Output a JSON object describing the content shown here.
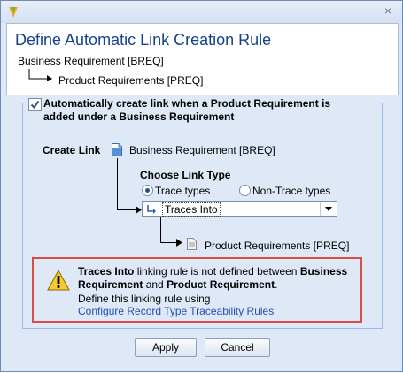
{
  "dialog": {
    "icons": {
      "app": "app-logo-icon",
      "close": "close-icon"
    },
    "close_glyph": "×"
  },
  "header": {
    "title": "Define Automatic Link Creation Rule",
    "source": "Business Requirement [BREQ]",
    "target": "Product Requirements [PREQ]"
  },
  "rule": {
    "checkbox_checked": true,
    "checkbox_label_line1": "Automatically create link when a Product Requirement is",
    "checkbox_label_line2": "added under a Business Requirement",
    "create_link_label": "Create Link",
    "create_link_source": "Business Requirement [BREQ]",
    "choose_link_type_label": "Choose Link Type",
    "radio_trace": "Trace types",
    "radio_non_trace": "Non-Trace types",
    "selected_radio": "trace",
    "link_type_value": "Traces Into",
    "link_target": "Product Requirements [PREQ]"
  },
  "warning": {
    "rule_name": "Traces Into",
    "text1": " linking rule is not defined between ",
    "from_type": "Business",
    "line2_bold1": "Requirement",
    "line2_mid": " and ",
    "line2_bold2": "Product Requirement",
    "line2_end": ".",
    "line3": "Define this linking rule using",
    "link_text": "Configure Record Type Traceability Rules"
  },
  "buttons": {
    "apply": "Apply",
    "cancel": "Cancel"
  },
  "colors": {
    "title": "#15428b",
    "warning_border": "#d94b45",
    "link": "#1e4fb0",
    "panel_bg": "#dfe8f6"
  }
}
